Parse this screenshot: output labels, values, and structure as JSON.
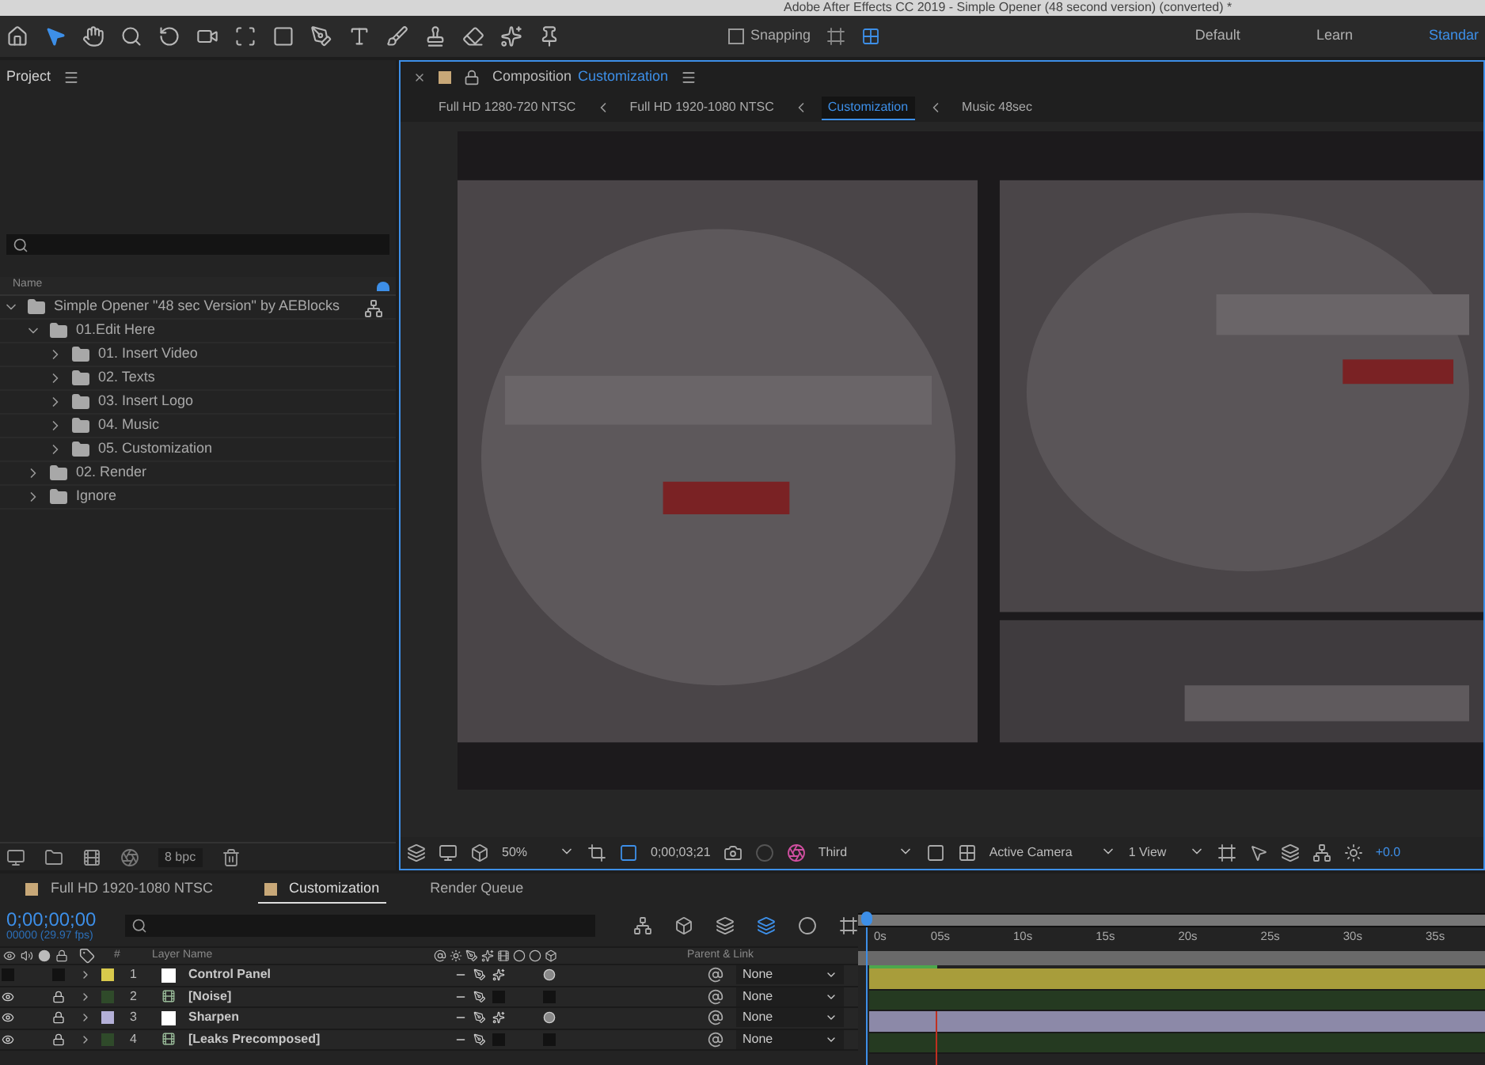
{
  "window": {
    "title": "Adobe After Effects CC 2019 - Simple Opener (48 second version) (converted) *"
  },
  "toolbar": {
    "snapping": {
      "label": "Snapping",
      "checked": false
    },
    "workspaces": [
      {
        "label": "Default",
        "selected": false
      },
      {
        "label": "Learn",
        "selected": false
      },
      {
        "label": "Standar",
        "selected": true
      }
    ]
  },
  "project": {
    "title": "Project",
    "column": "Name",
    "tree": [
      {
        "name": "Simple Opener \"48 sec Version\" by AEBlocks",
        "expanded": true,
        "children": [
          {
            "name": "01.Edit Here",
            "expanded": true,
            "children": [
              {
                "name": "01. Insert Video",
                "expanded": false
              },
              {
                "name": "02. Texts",
                "expanded": false
              },
              {
                "name": "03. Insert Logo",
                "expanded": false
              },
              {
                "name": "04. Music",
                "expanded": false
              },
              {
                "name": "05. Customization",
                "expanded": false
              }
            ]
          },
          {
            "name": "02. Render",
            "expanded": false
          },
          {
            "name": "Ignore",
            "expanded": false
          }
        ]
      }
    ],
    "bit_depth": "8 bpc"
  },
  "composition": {
    "tab_prefix": "Composition",
    "tab_name": "Customization",
    "breadcrumbs": [
      {
        "label": "Full HD 1280-720 NTSC",
        "selected": false
      },
      {
        "label": "Full HD 1920-1080 NTSC",
        "selected": false
      },
      {
        "label": "Customization",
        "selected": true
      },
      {
        "label": "Music 48sec",
        "selected": false
      }
    ],
    "controls": {
      "zoom": "50%",
      "time": "0;00;03;21",
      "resolution": "Third",
      "camera": "Active Camera",
      "views": "1 View",
      "exposure": "+0.0"
    }
  },
  "timeline": {
    "tabs": [
      {
        "label": "Full HD 1920-1080 NTSC",
        "selected": false
      },
      {
        "label": "Customization",
        "selected": true
      },
      {
        "label": "Render Queue",
        "selected": false
      }
    ],
    "timecode": "0;00;00;00",
    "frame_info": "00000 (29.97 fps)",
    "columns": {
      "number": "#",
      "name": "Layer Name",
      "parent": "Parent & Link"
    },
    "layers": [
      {
        "number": "1",
        "name": "Control Panel",
        "color": "#d8c94c",
        "kind": "solid",
        "visible": false,
        "locked": false,
        "fx": true,
        "adjustment": true,
        "parent": "None"
      },
      {
        "number": "2",
        "name": "[Noise]",
        "color": "#2f4a2a",
        "kind": "precomp",
        "visible": true,
        "locked": true,
        "fx": false,
        "adjustment": false,
        "parent": "None"
      },
      {
        "number": "3",
        "name": "Sharpen",
        "color": "#b4b0d8",
        "kind": "solid",
        "visible": true,
        "locked": true,
        "fx": true,
        "adjustment": true,
        "parent": "None"
      },
      {
        "number": "4",
        "name": "[Leaks Precomposed]",
        "color": "#2f4a2a",
        "kind": "precomp",
        "visible": true,
        "locked": true,
        "fx": false,
        "adjustment": false,
        "parent": "None"
      }
    ],
    "render_cache": {
      "level": 0.11
    },
    "ruler": [
      "0s",
      "05s",
      "10s",
      "15s",
      "20s",
      "25s",
      "30s",
      "35s"
    ]
  }
}
